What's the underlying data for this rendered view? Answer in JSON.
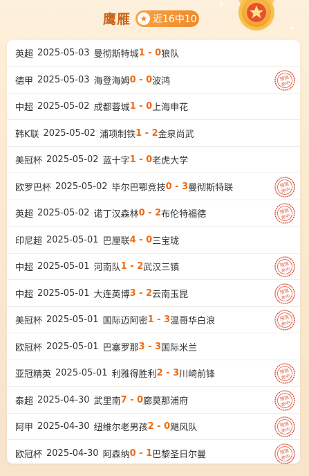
{
  "header": {
    "title": "鹰雁",
    "badge_text": "近16中10",
    "badge_icon": "star-icon",
    "medal_icon": "medal-star-icon"
  },
  "colors": {
    "accent": "#f08a2d",
    "title": "#c8651a",
    "score": "#f06a10",
    "stamp": "#e0523a"
  },
  "stamp_text": [
    "预测",
    "命中"
  ],
  "matches": [
    {
      "league": "英超",
      "date": "2025-05-03",
      "home": "曼彻斯特城",
      "home_score": "1",
      "away_score": "0",
      "away": "狼队",
      "hit": false
    },
    {
      "league": "德甲",
      "date": "2025-05-03",
      "home": "海登海姆",
      "home_score": "0",
      "away_score": "0",
      "away": "波鸿",
      "hit": true
    },
    {
      "league": "中超",
      "date": "2025-05-02",
      "home": "成都蓉城",
      "home_score": "1",
      "away_score": "0",
      "away": "上海申花",
      "hit": false
    },
    {
      "league": "韩K联",
      "date": "2025-05-02",
      "home": "浦项制铁",
      "home_score": "1",
      "away_score": "2",
      "away": "金泉尚武",
      "hit": false
    },
    {
      "league": "美冠杯",
      "date": "2025-05-02",
      "home": "蓝十字",
      "home_score": "1",
      "away_score": "0",
      "away": "老虎大学",
      "hit": false
    },
    {
      "league": "欧罗巴杯",
      "date": "2025-05-02",
      "home": "毕尔巴鄂竞技",
      "home_score": "0",
      "away_score": "3",
      "away": "曼彻斯特联",
      "hit": true
    },
    {
      "league": "英超",
      "date": "2025-05-02",
      "home": "诺丁汉森林",
      "home_score": "0",
      "away_score": "2",
      "away": "布伦特福德",
      "hit": true
    },
    {
      "league": "印尼超",
      "date": "2025-05-01",
      "home": "巴厘联",
      "home_score": "4",
      "away_score": "0",
      "away": "三宝珑",
      "hit": false
    },
    {
      "league": "中超",
      "date": "2025-05-01",
      "home": "河南队",
      "home_score": "1",
      "away_score": "2",
      "away": "武汉三镇",
      "hit": true
    },
    {
      "league": "中超",
      "date": "2025-05-01",
      "home": "大连英博",
      "home_score": "3",
      "away_score": "2",
      "away": "云南玉昆",
      "hit": true
    },
    {
      "league": "美冠杯",
      "date": "2025-05-01",
      "home": "国际迈阿密",
      "home_score": "1",
      "away_score": "3",
      "away": "温哥华白浪",
      "hit": true
    },
    {
      "league": "欧冠杯",
      "date": "2025-05-01",
      "home": "巴塞罗那",
      "home_score": "3",
      "away_score": "3",
      "away": "国际米兰",
      "hit": false
    },
    {
      "league": "亚冠精英",
      "date": "2025-05-01",
      "home": "利雅得胜利",
      "home_score": "2",
      "away_score": "3",
      "away": "川崎前锋",
      "hit": true
    },
    {
      "league": "泰超",
      "date": "2025-04-30",
      "home": "武里南",
      "home_score": "7",
      "away_score": "0",
      "away": "廊莫那浦府",
      "hit": true
    },
    {
      "league": "阿甲",
      "date": "2025-04-30",
      "home": "纽维尔老男孩",
      "home_score": "2",
      "away_score": "0",
      "away": "飓风队",
      "hit": true
    },
    {
      "league": "欧冠杯",
      "date": "2025-04-30",
      "home": "阿森纳",
      "home_score": "0",
      "away_score": "1",
      "away": "巴黎圣日尔曼",
      "hit": true
    }
  ]
}
